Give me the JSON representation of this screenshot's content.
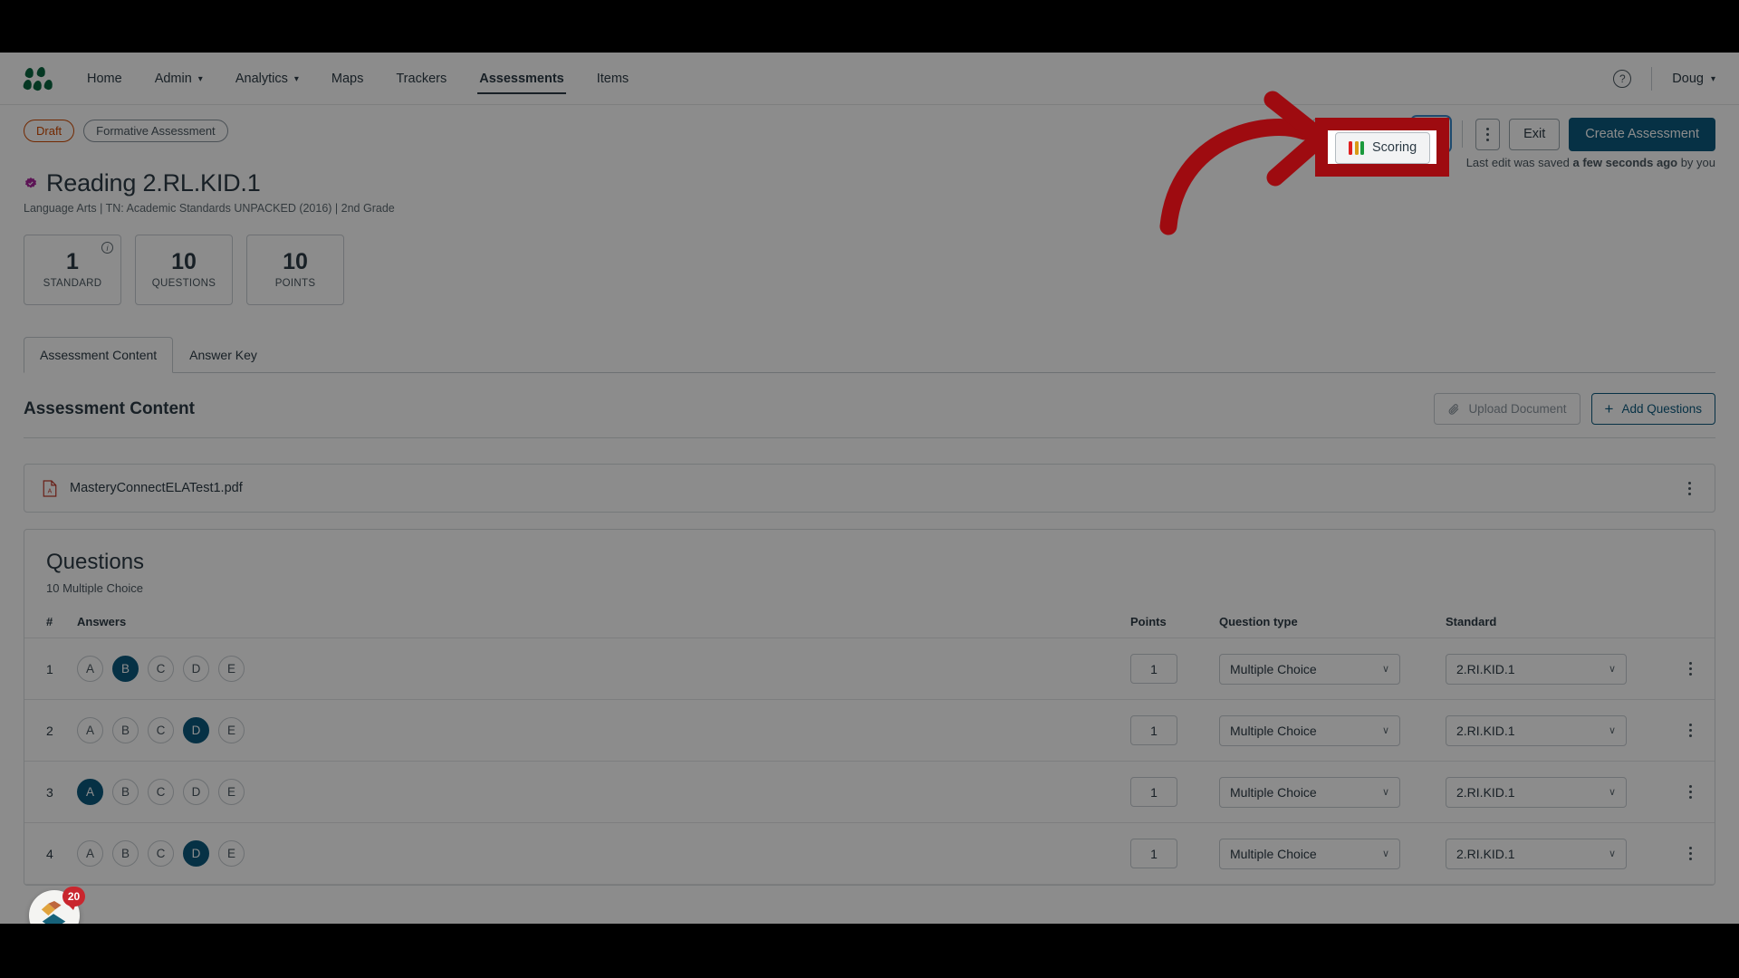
{
  "app": {
    "logo_icon": "masteryconnect-dots-logo"
  },
  "nav": {
    "items": [
      {
        "label": "Home",
        "has_caret": false,
        "active": false
      },
      {
        "label": "Admin",
        "has_caret": true,
        "active": false
      },
      {
        "label": "Analytics",
        "has_caret": true,
        "active": false
      },
      {
        "label": "Maps",
        "has_caret": false,
        "active": false
      },
      {
        "label": "Trackers",
        "has_caret": false,
        "active": false
      },
      {
        "label": "Assessments",
        "has_caret": false,
        "active": true
      },
      {
        "label": "Items",
        "has_caret": false,
        "active": false
      }
    ],
    "help_icon": "question-mark-circle-icon",
    "user": "Doug",
    "user_caret": "∨"
  },
  "header": {
    "status_pill": "Draft",
    "type_pill": "Formative Assessment",
    "verified_icon": "verified-badge-icon",
    "title": "Reading 2.RL.KID.1",
    "subtitle": "Language Arts  |  TN: Academic Standards UNPACKED (2016)  |  2nd Grade",
    "actions": {
      "scoring_label": "Scoring",
      "scoring_bar_colors": [
        "#e02020",
        "#d99a16",
        "#1a9a3c"
      ],
      "settings_icon": "gear-icon",
      "more_icon": "kebab-menu-icon",
      "exit_label": "Exit",
      "create_label": "Create Assessment"
    },
    "saved_prefix": "Last edit was saved ",
    "saved_bold": "a few seconds ago",
    "saved_suffix": " by you"
  },
  "stats": [
    {
      "value": "1",
      "label": "STANDARD",
      "info_icon": "info-circle-icon"
    },
    {
      "value": "10",
      "label": "QUESTIONS",
      "info_icon": ""
    },
    {
      "value": "10",
      "label": "POINTS",
      "info_icon": ""
    }
  ],
  "tabs": [
    {
      "label": "Assessment Content",
      "active": true
    },
    {
      "label": "Answer Key",
      "active": false
    }
  ],
  "section": {
    "title": "Assessment Content",
    "upload_label": "Upload Document",
    "upload_icon": "paperclip-icon",
    "add_label": "Add Questions",
    "add_icon": "plus-icon"
  },
  "file": {
    "name": "MasteryConnectELATest1.pdf",
    "icon": "pdf-file-icon",
    "menu_icon": "kebab-menu-icon"
  },
  "questions": {
    "heading": "Questions",
    "subheading": "10 Multiple Choice",
    "columns": {
      "number": "#",
      "answers": "Answers",
      "points": "Points",
      "type": "Question type",
      "standard": "Standard"
    },
    "choices": [
      "A",
      "B",
      "C",
      "D",
      "E"
    ],
    "rows": [
      {
        "num": "1",
        "selected": "B",
        "points": "1",
        "type": "Multiple Choice",
        "standard": "2.RI.KID.1"
      },
      {
        "num": "2",
        "selected": "D",
        "points": "1",
        "type": "Multiple Choice",
        "standard": "2.RI.KID.1"
      },
      {
        "num": "3",
        "selected": "A",
        "points": "1",
        "type": "Multiple Choice",
        "standard": "2.RI.KID.1"
      },
      {
        "num": "4",
        "selected": "D",
        "points": "1",
        "type": "Multiple Choice",
        "standard": "2.RI.KID.1"
      }
    ],
    "chevron": "∨",
    "row_menu_icon": "kebab-menu-icon"
  },
  "pendo": {
    "count": "20",
    "icon": "pendo-resource-center-icon"
  },
  "annotation": {
    "arrow_color": "#9e0b10",
    "highlight_target": "scoring-button"
  },
  "colors": {
    "primary": "#0c5a7e",
    "draft": "#cf4a00",
    "logo_green": "#0a6640",
    "annotation_red": "#9e0b10"
  }
}
